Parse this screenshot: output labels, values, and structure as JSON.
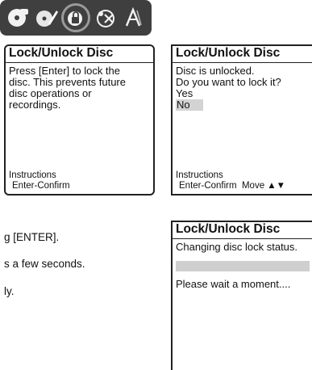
{
  "icon_bar": {
    "icons": [
      "disc-icon",
      "edit-icon",
      "lock-disc-icon",
      "settings-icon",
      "text-a-icon"
    ],
    "selected_index": 2
  },
  "panel1": {
    "title": "Lock/Unlock Disc",
    "lines": [
      "Press [Enter] to lock the",
      "disc. This prevents future",
      "disc operations or",
      "recordings."
    ],
    "instructions_label": "Instructions",
    "instructions_keys": "Enter-Confirm"
  },
  "panel2": {
    "title": "Lock/Unlock Disc",
    "lines": [
      "Disc is unlocked.",
      "Do you want to lock it?"
    ],
    "option_yes": "Yes",
    "option_no": "No",
    "instructions_label": "Instructions",
    "instructions_keys": "Enter-Confirm",
    "instructions_move": "Move ▲▼"
  },
  "panel3": {
    "title": "Lock/Unlock Disc",
    "status": "Changing disc lock status.",
    "wait": "Please wait a moment...."
  },
  "side_text": {
    "line1": "g [ENTER].",
    "line2": "s a few seconds.",
    "line3": "ly."
  }
}
